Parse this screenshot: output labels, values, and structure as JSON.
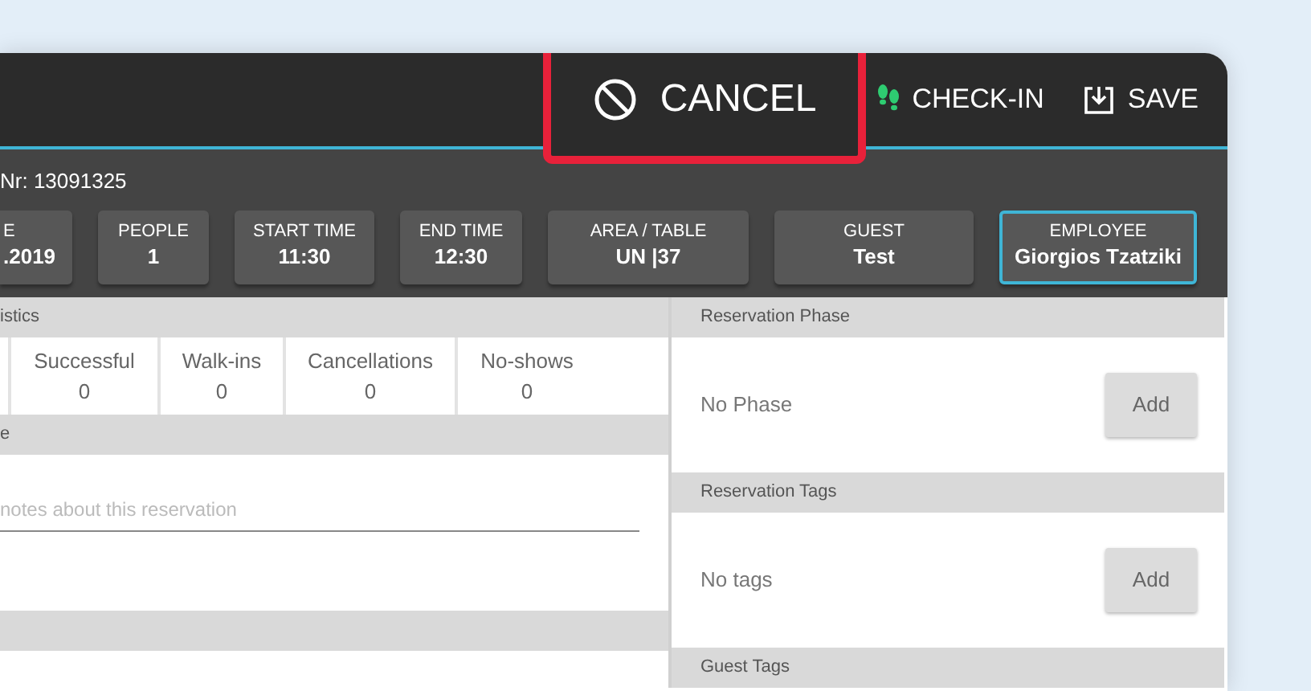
{
  "header": {
    "actions": [
      {
        "kind": "cancel",
        "label": "CANCEL",
        "highlighted": true
      },
      {
        "kind": "check_in",
        "label": "CHECK-IN",
        "highlighted": false
      },
      {
        "kind": "save",
        "label": "SAVE",
        "highlighted": false
      }
    ]
  },
  "reservation_number": "Nr: 13091325",
  "fields": [
    {
      "label": "E",
      "value": ".2019",
      "selected": false
    },
    {
      "label": "PEOPLE",
      "value": "1",
      "selected": false
    },
    {
      "label": "START TIME",
      "value": "11:30",
      "selected": false
    },
    {
      "label": "END TIME",
      "value": "12:30",
      "selected": false
    },
    {
      "label": "AREA / TABLE",
      "value": "UN |37",
      "selected": false
    },
    {
      "label": "GUEST",
      "value": "Test",
      "selected": false
    },
    {
      "label": "EMPLOYEE",
      "value": "Giorgios Tzatziki",
      "selected": true
    }
  ],
  "statistics": {
    "title": "istics",
    "items": [
      {
        "label": "Successful",
        "value": "0"
      },
      {
        "label": "Walk-ins",
        "value": "0"
      },
      {
        "label": "Cancellations",
        "value": "0"
      },
      {
        "label": "No-shows",
        "value": "0"
      }
    ]
  },
  "note": {
    "title": "e",
    "placeholder": "notes about this reservation"
  },
  "panels": [
    {
      "title": "Reservation Phase",
      "text": "No Phase",
      "button": "Add"
    },
    {
      "title": "Reservation Tags",
      "text": "No tags",
      "button": "Add"
    },
    {
      "title": "Guest Tags"
    }
  ]
}
